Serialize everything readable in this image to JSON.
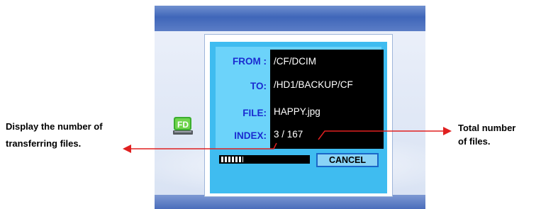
{
  "dialog": {
    "from_label": "FROM :",
    "from_value": "/CF/DCIM",
    "to_label": "TO:",
    "to_value": "/HD1/BACKUP/CF",
    "file_label": "FILE:",
    "file_value": "HAPPY.jpg",
    "index_label": "INDEX:",
    "index_value": "3 / 167",
    "cancel_label": "CANCEL",
    "progress_fraction": 0.25
  },
  "icon": {
    "name": "fd-drive-icon",
    "text": "FD"
  },
  "annotations": {
    "left_line1": "Display the number of",
    "left_line2": "transferring files.",
    "right_line1": "Total number",
    "right_line2": "of files."
  },
  "colors": {
    "label": "#1a2bd0",
    "arrow": "#e02020",
    "dialog_outer": "#3fbcf0",
    "dialog_panel": "#6cd3fa"
  }
}
